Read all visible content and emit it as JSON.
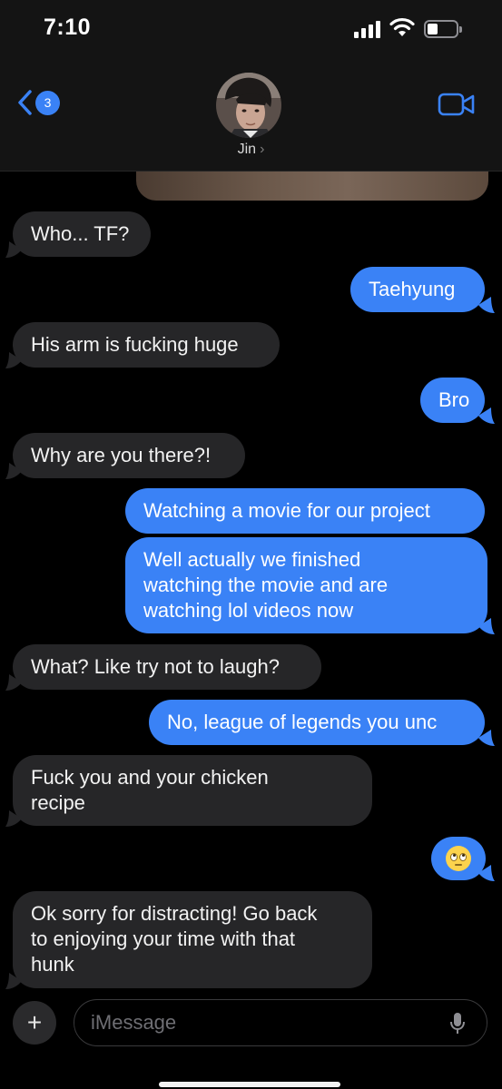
{
  "status_bar": {
    "time": "7:10"
  },
  "header": {
    "back_badge": "3",
    "contact_name": "Jin",
    "contact_chevron": "›",
    "icons": {
      "back": "chevron-left-icon",
      "video": "video-camera-icon"
    }
  },
  "messages": [
    {
      "from": "them",
      "text": "Who... TF?"
    },
    {
      "from": "me",
      "text": "Taehyung"
    },
    {
      "from": "them",
      "text": "His arm is fucking huge"
    },
    {
      "from": "me",
      "text": "Bro"
    },
    {
      "from": "them",
      "text": "Why are you there?!"
    },
    {
      "from": "me",
      "text": "Watching a movie for our project"
    },
    {
      "from": "me",
      "text": "Well actually we finished\nwatching the movie and are\nwatching lol videos now"
    },
    {
      "from": "them",
      "text": "What? Like try not to laugh?"
    },
    {
      "from": "me",
      "text": "No, league of legends you unc"
    },
    {
      "from": "them",
      "text": "Fuck you and your chicken\nrecipe"
    },
    {
      "from": "me",
      "emoji": "face-with-rolling-eyes"
    },
    {
      "from": "them",
      "text": "Ok sorry for distracting! Go back\nto enjoying your time with that\nhunk"
    }
  ],
  "composer": {
    "plus_label": "+",
    "placeholder": "iMessage",
    "icons": {
      "mic": "microphone-icon"
    }
  },
  "colors": {
    "outgoing": "#3a82f6",
    "incoming": "#262628",
    "background": "#000000"
  }
}
